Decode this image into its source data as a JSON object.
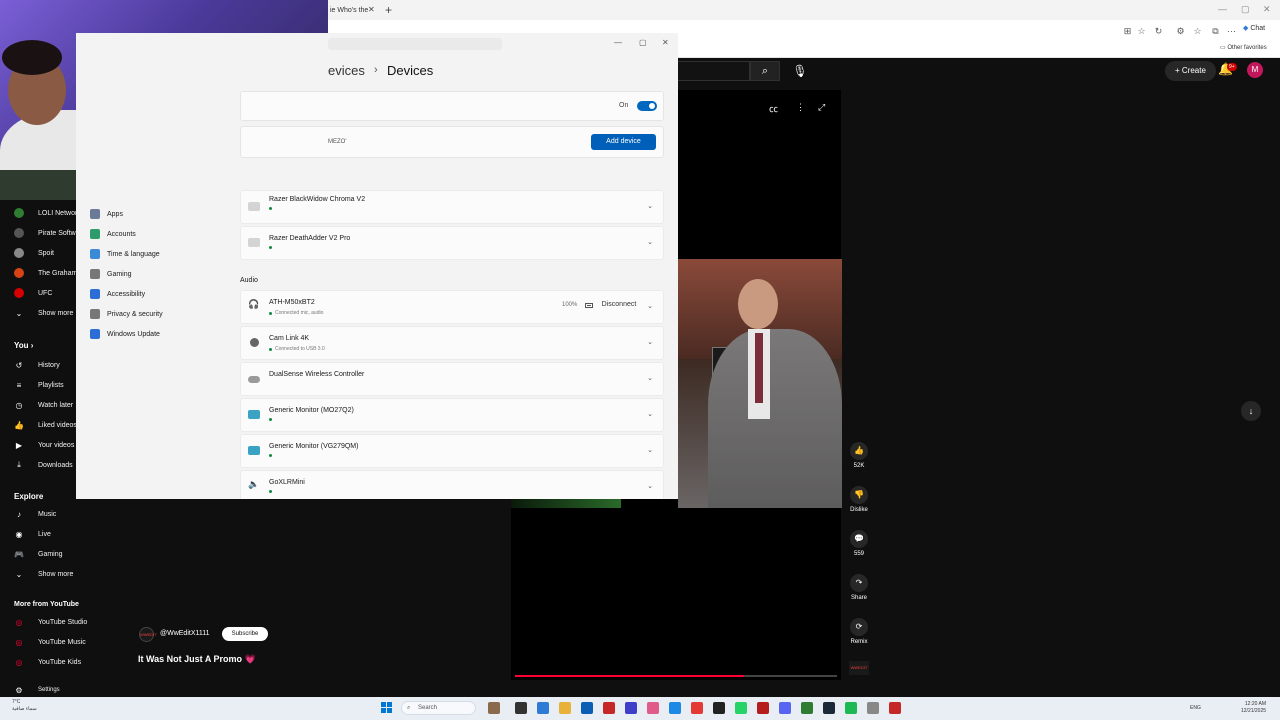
{
  "browser": {
    "tab_title": "ie Who's the",
    "tab_close": "✕",
    "new_tab": "+",
    "chat_label": "Chat",
    "other_favorites": "Other favorites"
  },
  "youtube": {
    "create_label": "Create",
    "notification_count": "9+",
    "avatar_initial": "M",
    "sidebar_subscriptions": [
      {
        "label": "LOLI Network",
        "color": "#2e7d32"
      },
      {
        "label": "Pirate Softw",
        "color": "#555555"
      },
      {
        "label": "Spoit",
        "color": "#888888"
      },
      {
        "label": "The Graham",
        "color": "#d84315"
      },
      {
        "label": "UFC",
        "color": "#d50000"
      }
    ],
    "show_more_1": "Show more",
    "you_heading": "You",
    "you_items": [
      "History",
      "Playlists",
      "Watch later",
      "Liked videos",
      "Your videos",
      "Downloads"
    ],
    "explore_heading": "Explore",
    "explore_items": [
      "Music",
      "Live",
      "Gaming"
    ],
    "show_more_2": "Show more",
    "more_heading": "More from YouTube",
    "more_items": [
      "YouTube Studio",
      "YouTube Music",
      "YouTube Kids"
    ],
    "settings_label": "Settings",
    "channel_handle": "@WwEditX1111",
    "channel_logo": "WWEDIT",
    "subscribe_label": "Subscribe",
    "video_title": "It Was Not Just A Promo 💗",
    "actions": [
      {
        "icon": "👍",
        "label": "52K"
      },
      {
        "icon": "👎",
        "label": "Dislike"
      },
      {
        "icon": "💬",
        "label": "559"
      },
      {
        "icon": "↷",
        "label": "Share"
      },
      {
        "icon": "⟳",
        "label": "Remix"
      }
    ],
    "progress": 0.71
  },
  "settings": {
    "breadcrumb_parent": "evices",
    "breadcrumb_sep": "›",
    "breadcrumb_current": "Devices",
    "bluetooth_toggle_label": "On",
    "pc_name": "MEZO'",
    "add_device_label": "Add device",
    "nav_items": [
      {
        "label": "Apps",
        "color": "#6b7a99"
      },
      {
        "label": "Accounts",
        "color": "#2e9c6a"
      },
      {
        "label": "Time & language",
        "color": "#3a8ad6"
      },
      {
        "label": "Gaming",
        "color": "#777777"
      },
      {
        "label": "Accessibility",
        "color": "#2a6ed6"
      },
      {
        "label": "Privacy & security",
        "color": "#777777"
      },
      {
        "label": "Windows Update",
        "color": "#2a6ed6"
      }
    ],
    "input_devices": [
      {
        "name": "Razer BlackWidow Chroma V2",
        "status": ""
      },
      {
        "name": "Razer DeathAdder V2 Pro",
        "status": ""
      }
    ],
    "audio_heading": "Audio",
    "audio_devices": [
      {
        "name": "ATH-M50xBT2",
        "status": "Connected mic, audio",
        "battery": "100%",
        "action": "Disconnect",
        "icon": "headphones"
      },
      {
        "name": "Cam Link 4K",
        "status": "Connected to USB 3.0",
        "icon": "camera"
      },
      {
        "name": "DualSense Wireless Controller",
        "status": "",
        "icon": "gamepad"
      },
      {
        "name": "Generic Monitor (MO27Q2)",
        "status": "",
        "icon": "monitor"
      },
      {
        "name": "Generic Monitor (VG279QM)",
        "status": "",
        "icon": "monitor"
      },
      {
        "name": "GoXLRMini",
        "status": "",
        "icon": "speaker"
      }
    ]
  },
  "taskbar": {
    "weather_temp": "7°C",
    "weather_text": "سماء صافية",
    "search_label": "Search",
    "language": "ENG",
    "time": "12:20 AM",
    "date": "12/21/2025"
  }
}
